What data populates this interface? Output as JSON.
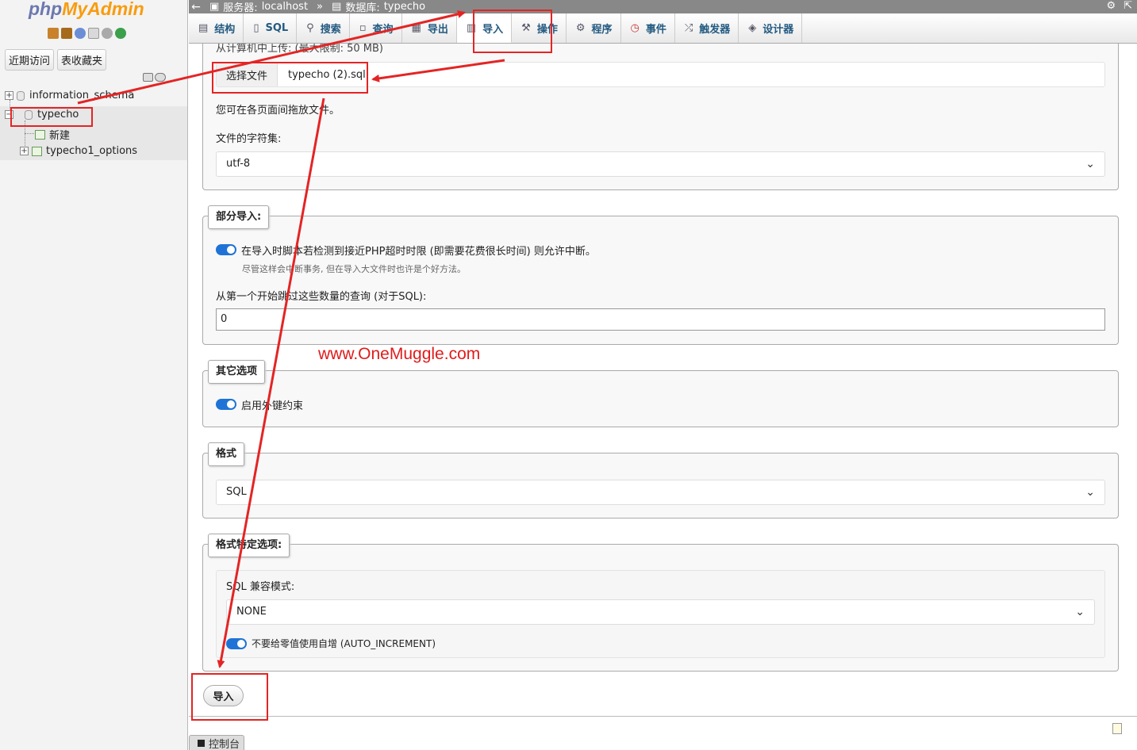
{
  "nav": {
    "logo_php": "php",
    "logo_myadmin": "MyAdmin",
    "recent_label": "近期访问",
    "favorites_label": "表收藏夹",
    "databases": [
      {
        "name": "information_schema"
      },
      {
        "name": "typecho"
      }
    ],
    "typecho_children": [
      {
        "label": "新建"
      },
      {
        "label": "typecho1_options"
      }
    ]
  },
  "topbar": {
    "server_label": "服务器:",
    "server_value": "localhost",
    "sep": "»",
    "db_label": "数据库:",
    "db_value": "typecho"
  },
  "tabs": [
    {
      "label": "结构",
      "icon": "structure-icon"
    },
    {
      "label": "SQL",
      "icon": "sql-icon"
    },
    {
      "label": "搜索",
      "icon": "search-icon"
    },
    {
      "label": "查询",
      "icon": "query-icon"
    },
    {
      "label": "导出",
      "icon": "export-icon"
    },
    {
      "label": "导入",
      "icon": "import-icon",
      "active": true
    },
    {
      "label": "操作",
      "icon": "wrench-icon"
    },
    {
      "label": "程序",
      "icon": "routines-icon"
    },
    {
      "label": "事件",
      "icon": "events-icon"
    },
    {
      "label": "触发器",
      "icon": "triggers-icon"
    },
    {
      "label": "设计器",
      "icon": "designer-icon"
    }
  ],
  "upload": {
    "partial_label": "从计算机中上传: (最大限制: 50 MB)",
    "choose_file": "选择文件",
    "file_name": "typecho (2).sql",
    "drag_hint": "您可在各页面间拖放文件。",
    "charset_label": "文件的字符集:",
    "charset_value": "utf-8"
  },
  "partial_import": {
    "legend": "部分导入:",
    "interrupt_label": "在导入时脚本若检测到接近PHP超时时限 (即需要花费很长时间) 则允许中断。",
    "interrupt_hint": "尽管这样会中断事务, 但在导入大文件时也许是个好方法。",
    "interrupt_enabled": true,
    "skip_label": "从第一个开始跳过这些数量的查询 (对于SQL):",
    "skip_value": "0"
  },
  "watermark": "www.OneMuggle.com",
  "other_options": {
    "legend": "其它选项",
    "fk_label": "启用外键约束",
    "fk_enabled": true
  },
  "format": {
    "legend": "格式",
    "value": "SQL"
  },
  "format_options": {
    "legend": "格式特定选项:",
    "compat_label": "SQL 兼容模式:",
    "compat_value": "NONE",
    "auto_inc_label": "不要给零值使用自增 (AUTO_INCREMENT)",
    "auto_inc_enabled": true
  },
  "import_button": "导入",
  "console_label": "控制台",
  "colors": {
    "accent_link": "#235a81",
    "toggle_on": "#1f73d6",
    "annotation_red": "#e42424",
    "topbar_bg": "#888888"
  }
}
